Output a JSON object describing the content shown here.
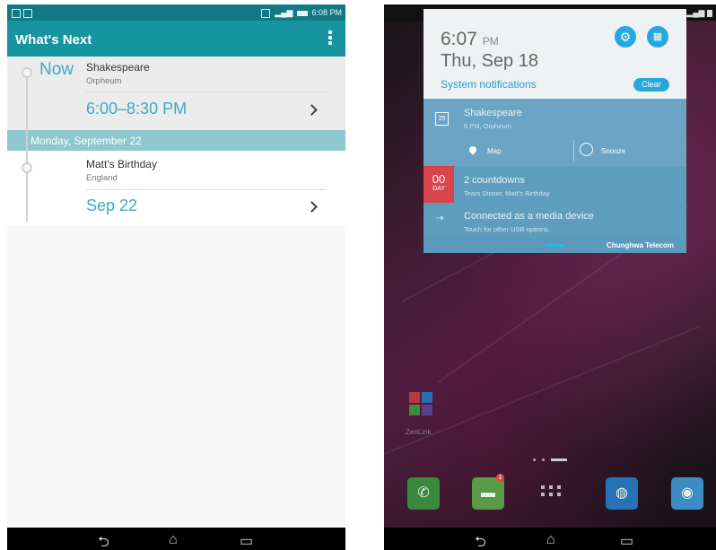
{
  "left": {
    "status_time": "6:08 PM",
    "app_title": "What's Next",
    "now_label": "Now",
    "event1": {
      "title": "Shakespeare",
      "location": "Orpheum",
      "time": "6:00–8:30 PM"
    },
    "day_header": "Monday, September 22",
    "event2": {
      "title": "Matt's Birthday",
      "location": "England",
      "date": "Sep 22"
    },
    "nav": {
      "back": "⮌",
      "home": "⌂",
      "recent": "▭"
    }
  },
  "right": {
    "clock_time": "6:07",
    "clock_ampm": "PM",
    "date": "Thu, Sep 18",
    "system_notifications": "System notifications",
    "clear_label": "Clear",
    "gear_glyph": "⚙",
    "qs_glyph": "▦",
    "notif_event": {
      "cal_day": "25",
      "title": "Shakespeare",
      "sub": "6 PM, Orpheum"
    },
    "actions": {
      "map": "Map",
      "snooze": "Snooze"
    },
    "countdown": {
      "number": "00",
      "unit": "DAY",
      "title": "2 countdowns",
      "sub": "Team Dinner, Matt's Birthday"
    },
    "usb": {
      "title": "Connected as a media device",
      "sub": "Touch for other USB options."
    },
    "carrier": "Chunghwa Telecom",
    "zenlink_label": "ZenLink",
    "sms_badge": "1",
    "nav": {
      "back": "⮌",
      "home": "⌂",
      "recent": "▭"
    }
  },
  "colors": {
    "teal_bar": "#16949f",
    "teal_status": "#127a85",
    "accent_blue": "#3aa9c6",
    "day_band": "#8fc8ce",
    "shade_blue": "#5f9dbf",
    "badge_red": "#d9434b",
    "action_blue": "#27a8dc"
  },
  "icons": [
    "notification-icon",
    "signal-icon",
    "battery-icon",
    "overflow-menu-icon",
    "chevron-right-icon",
    "calendar-icon",
    "map-pin-icon",
    "alarm-icon",
    "usb-icon",
    "gear-icon",
    "quick-settings-icon",
    "phone-icon",
    "messaging-icon",
    "app-drawer-icon",
    "browser-icon",
    "camera-icon",
    "back-icon",
    "home-icon",
    "recent-apps-icon"
  ]
}
